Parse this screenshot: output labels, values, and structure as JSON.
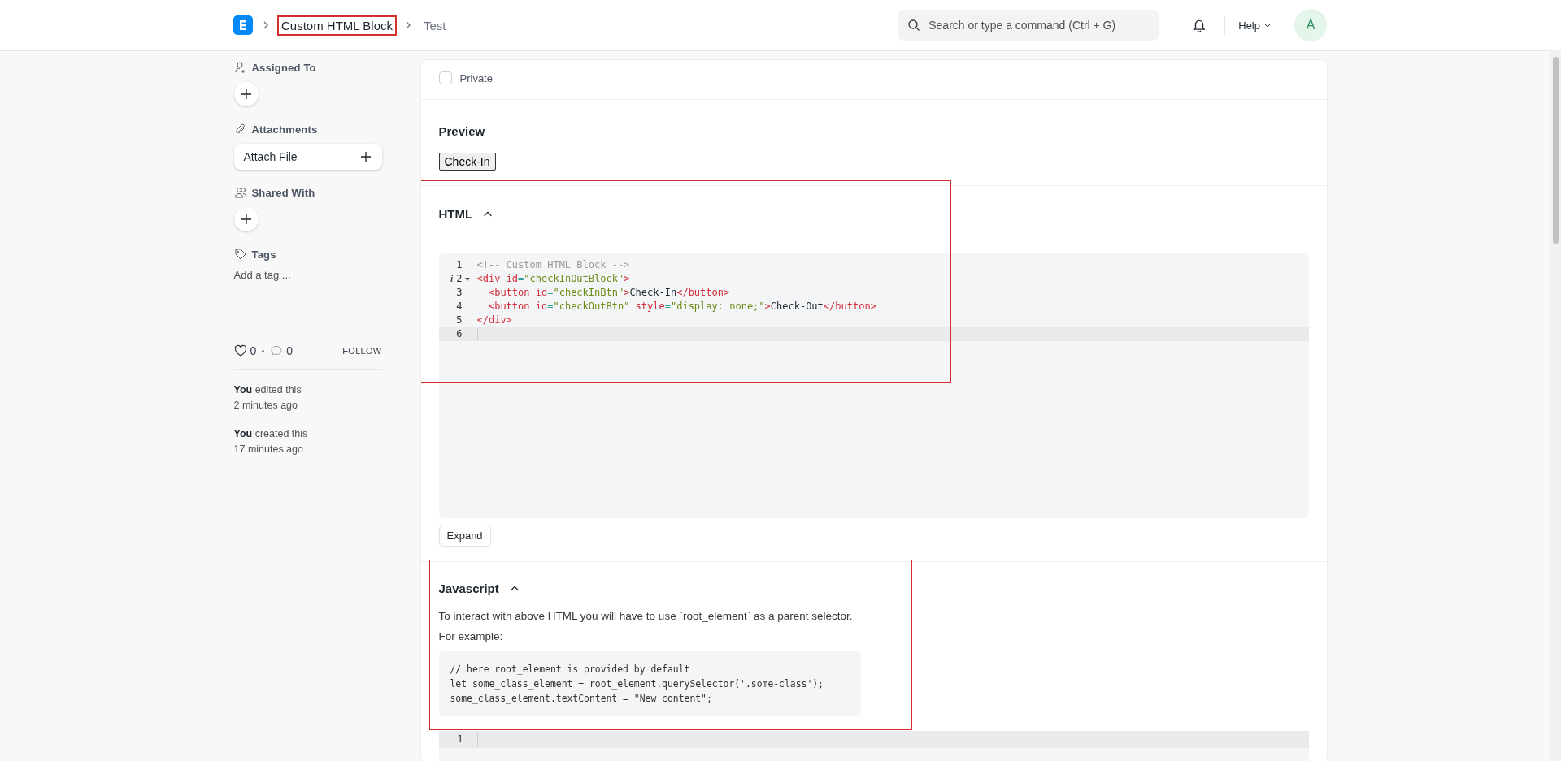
{
  "navbar": {
    "breadcrumbs": [
      {
        "label": "Custom HTML Block",
        "highlighted": true
      },
      {
        "label": "Test",
        "highlighted": false
      }
    ],
    "search": {
      "placeholder": "Search or type a command (Ctrl + G)"
    },
    "help": "Help",
    "avatar": "A"
  },
  "sidebar": {
    "assigned_to": "Assigned To",
    "attachments": "Attachments",
    "attach_file": "Attach File",
    "shared_with": "Shared With",
    "tags": "Tags",
    "add_tag": "Add a tag ...",
    "likes": "0",
    "comments": "0",
    "follow": "FOLLOW",
    "activity": [
      {
        "text": "**You** edited this",
        "time": "2 minutes ago"
      },
      {
        "text": "**You** created this",
        "time": "17 minutes ago"
      }
    ]
  },
  "form": {
    "private": {
      "label": "Private",
      "checked": false
    },
    "preview": {
      "title": "Preview",
      "button": "Check-In"
    },
    "html": {
      "title": "HTML",
      "expanded": true,
      "highlighted": true,
      "lines": [
        {
          "number": "1",
          "fold": false,
          "active": false,
          "tokens": [
            {
              "kind": "comment",
              "text": "<!-- Custom HTML Block -->"
            }
          ]
        },
        {
          "number": "2",
          "info_mark": "i",
          "fold": true,
          "active": false,
          "tokens": [
            {
              "kind": "tag",
              "text": "<div"
            },
            {
              "kind": "attr",
              "text": " id"
            },
            {
              "kind": "punct",
              "text": "="
            },
            {
              "kind": "string",
              "text": "\"checkInOutBlock\""
            },
            {
              "kind": "tag",
              "text": ">"
            }
          ]
        },
        {
          "number": "3",
          "fold": false,
          "active": false,
          "tokens": [
            {
              "kind": "tag",
              "text": "  <button"
            },
            {
              "kind": "attr",
              "text": " id"
            },
            {
              "kind": "punct",
              "text": "="
            },
            {
              "kind": "string",
              "text": "\"checkInBtn\""
            },
            {
              "kind": "tag",
              "text": ">"
            },
            {
              "kind": "text",
              "text": "Check-In"
            },
            {
              "kind": "tag",
              "text": "</button>"
            }
          ]
        },
        {
          "number": "4",
          "fold": false,
          "active": false,
          "tokens": [
            {
              "kind": "tag",
              "text": "  <button"
            },
            {
              "kind": "attr",
              "text": " id"
            },
            {
              "kind": "punct",
              "text": "="
            },
            {
              "kind": "string",
              "text": "\"checkOutBtn\""
            },
            {
              "kind": "attr",
              "text": " style"
            },
            {
              "kind": "punct",
              "text": "="
            },
            {
              "kind": "string",
              "text": "\"display: none;\""
            },
            {
              "kind": "tag",
              "text": ">"
            },
            {
              "kind": "text",
              "text": "Check-Out"
            },
            {
              "kind": "tag",
              "text": "</button>"
            }
          ]
        },
        {
          "number": "5",
          "fold": false,
          "active": false,
          "tokens": [
            {
              "kind": "tag",
              "text": "</div>"
            }
          ]
        },
        {
          "number": "6",
          "fold": false,
          "active": true
        }
      ],
      "expand": "Expand"
    },
    "javascript": {
      "title": "Javascript",
      "expanded": true,
      "highlighted": true,
      "description": "To interact with above HTML you will have to use `root_element` as a parent selector.",
      "example_label": "For example:",
      "example": [
        "// here root_element is provided by default",
        "let some_class_element = root_element.querySelector('.some-class');",
        "some_class_element.textContent = \"New content\";"
      ],
      "lines": [
        {
          "number": "1",
          "active": true
        }
      ]
    }
  }
}
